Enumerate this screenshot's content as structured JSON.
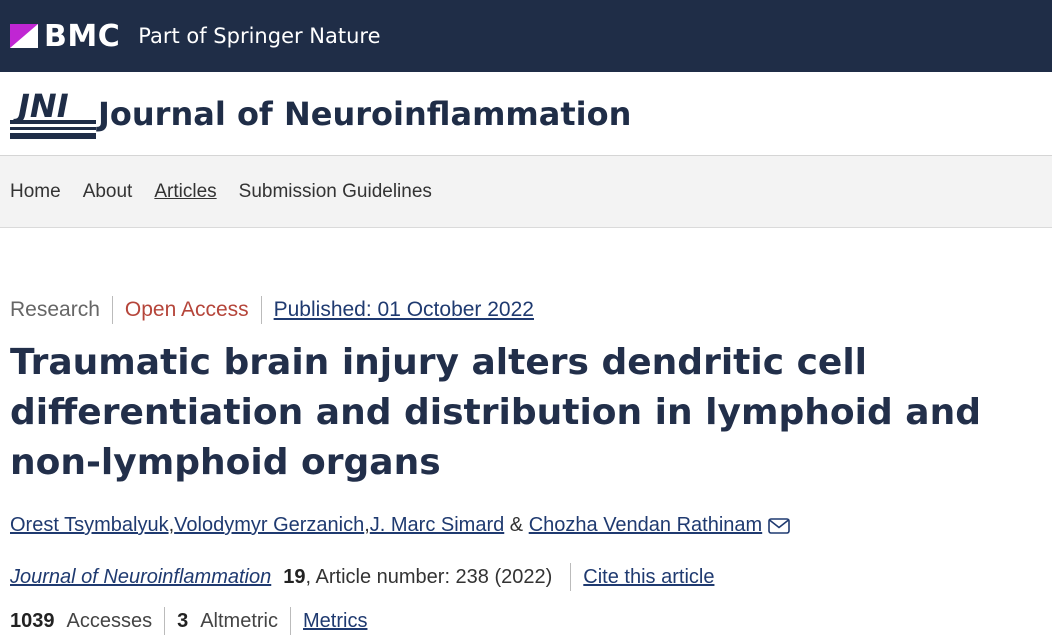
{
  "brand": {
    "name": "BMC",
    "tagline": "Part of Springer Nature",
    "accent": "#c026d3"
  },
  "journal": {
    "logo_text": "JNI",
    "name": "Journal of Neuroinflammation"
  },
  "nav": {
    "items": [
      {
        "label": "Home"
      },
      {
        "label": "About"
      },
      {
        "label": "Articles"
      },
      {
        "label": "Submission Guidelines"
      }
    ]
  },
  "article": {
    "type": "Research",
    "access": "Open Access",
    "published": "Published: 01 October 2022",
    "title": "Traumatic brain injury alters dendritic cell differentiation and distribution in lymphoid and non-lymphoid organs",
    "authors": [
      {
        "name": "Orest Tsymbalyuk"
      },
      {
        "name": "Volodymyr Gerzanich"
      },
      {
        "name": "J. Marc Simard"
      },
      {
        "name": "Chozha Vendan Rathinam"
      }
    ],
    "author_separators": [
      ", ",
      ", ",
      " & "
    ],
    "citation": {
      "journal": "Journal of Neuroinflammation",
      "volume": "19",
      "detail": ", Article number: 238 (2022)",
      "cite_label": "Cite this article"
    },
    "metrics": {
      "accesses_value": "1039",
      "accesses_label": "Accesses",
      "altmetric_value": "3",
      "altmetric_label": "Altmetric",
      "metrics_label": "Metrics"
    }
  },
  "icons": {
    "mail": "mail-icon"
  }
}
